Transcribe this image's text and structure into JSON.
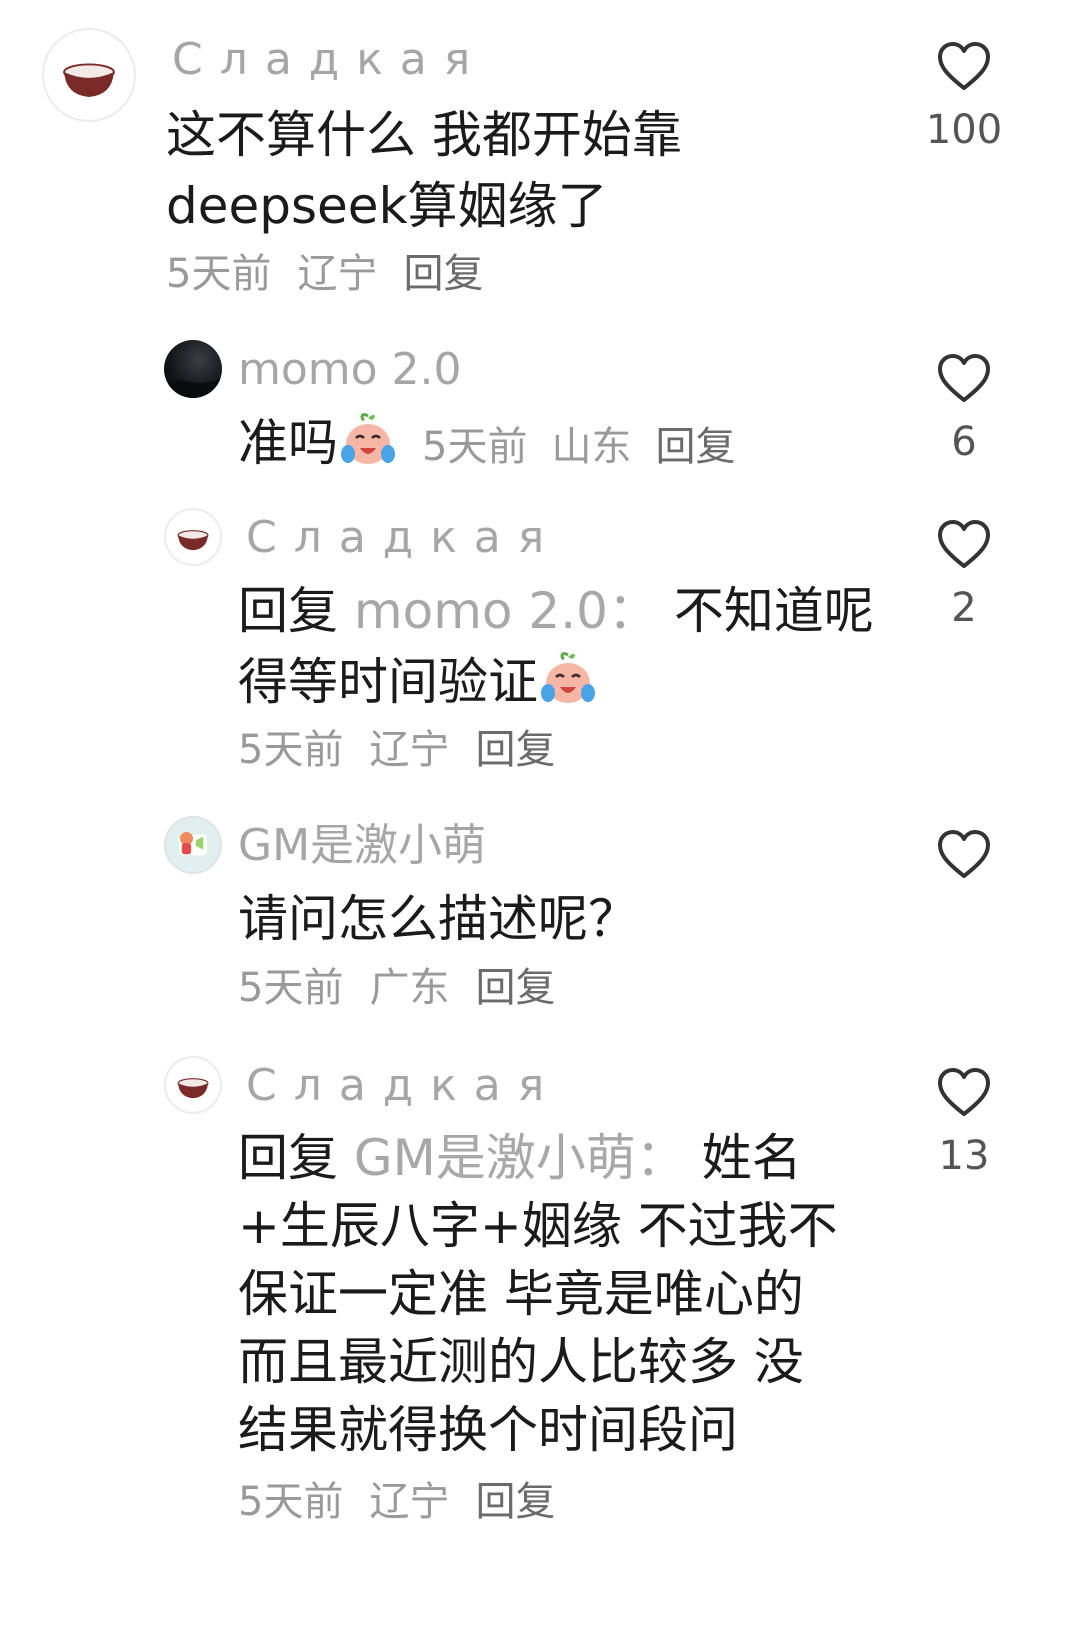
{
  "comments": [
    {
      "user": "Сладкая",
      "line1": "这不算什么 我都开始靠",
      "line2": "deepseek算姻缘了",
      "time": "5天前",
      "location": "辽宁",
      "reply_label": "回复",
      "likes": "100",
      "avatar_icon": "bowl-icon"
    },
    {
      "user": "momo 2.0",
      "text": "准吗",
      "emoji": "crying-laughing-emoji",
      "time": "5天前",
      "location": "山东",
      "reply_label": "回复",
      "likes": "6",
      "avatar_icon": "night-sky-avatar"
    },
    {
      "user": "Сладкая",
      "reply_prefix": "回复",
      "reply_to": "momo 2.0：",
      "line1": "不知道呢",
      "line2": "得等时间验证",
      "emoji": "crying-laughing-emoji",
      "time": "5天前",
      "location": "辽宁",
      "reply_label": "回复",
      "likes": "2",
      "avatar_icon": "bowl-icon"
    },
    {
      "user": "GM是激小萌",
      "text": "请问怎么描述呢？",
      "time": "5天前",
      "location": "广东",
      "reply_label": "回复",
      "likes": "",
      "avatar_icon": "cartoon-avatar"
    },
    {
      "user": "Сладкая",
      "reply_prefix": "回复",
      "reply_to": "GM是激小萌：",
      "line1": "姓名",
      "line2": "+生辰八字+姻缘 不过我不",
      "line3": "保证一定准 毕竟是唯心的",
      "line4": "而且最近测的人比较多 没",
      "line5": "结果就得换个时间段问",
      "time": "5天前",
      "location": "辽宁",
      "reply_label": "回复",
      "likes": "13",
      "avatar_icon": "bowl-icon"
    }
  ],
  "colors": {
    "username": "#a6a6a6",
    "text": "#1b1b1b",
    "meta": "#9a9a9a",
    "reply_button": "#6b6b6b",
    "bowl": "#7a2a28"
  }
}
